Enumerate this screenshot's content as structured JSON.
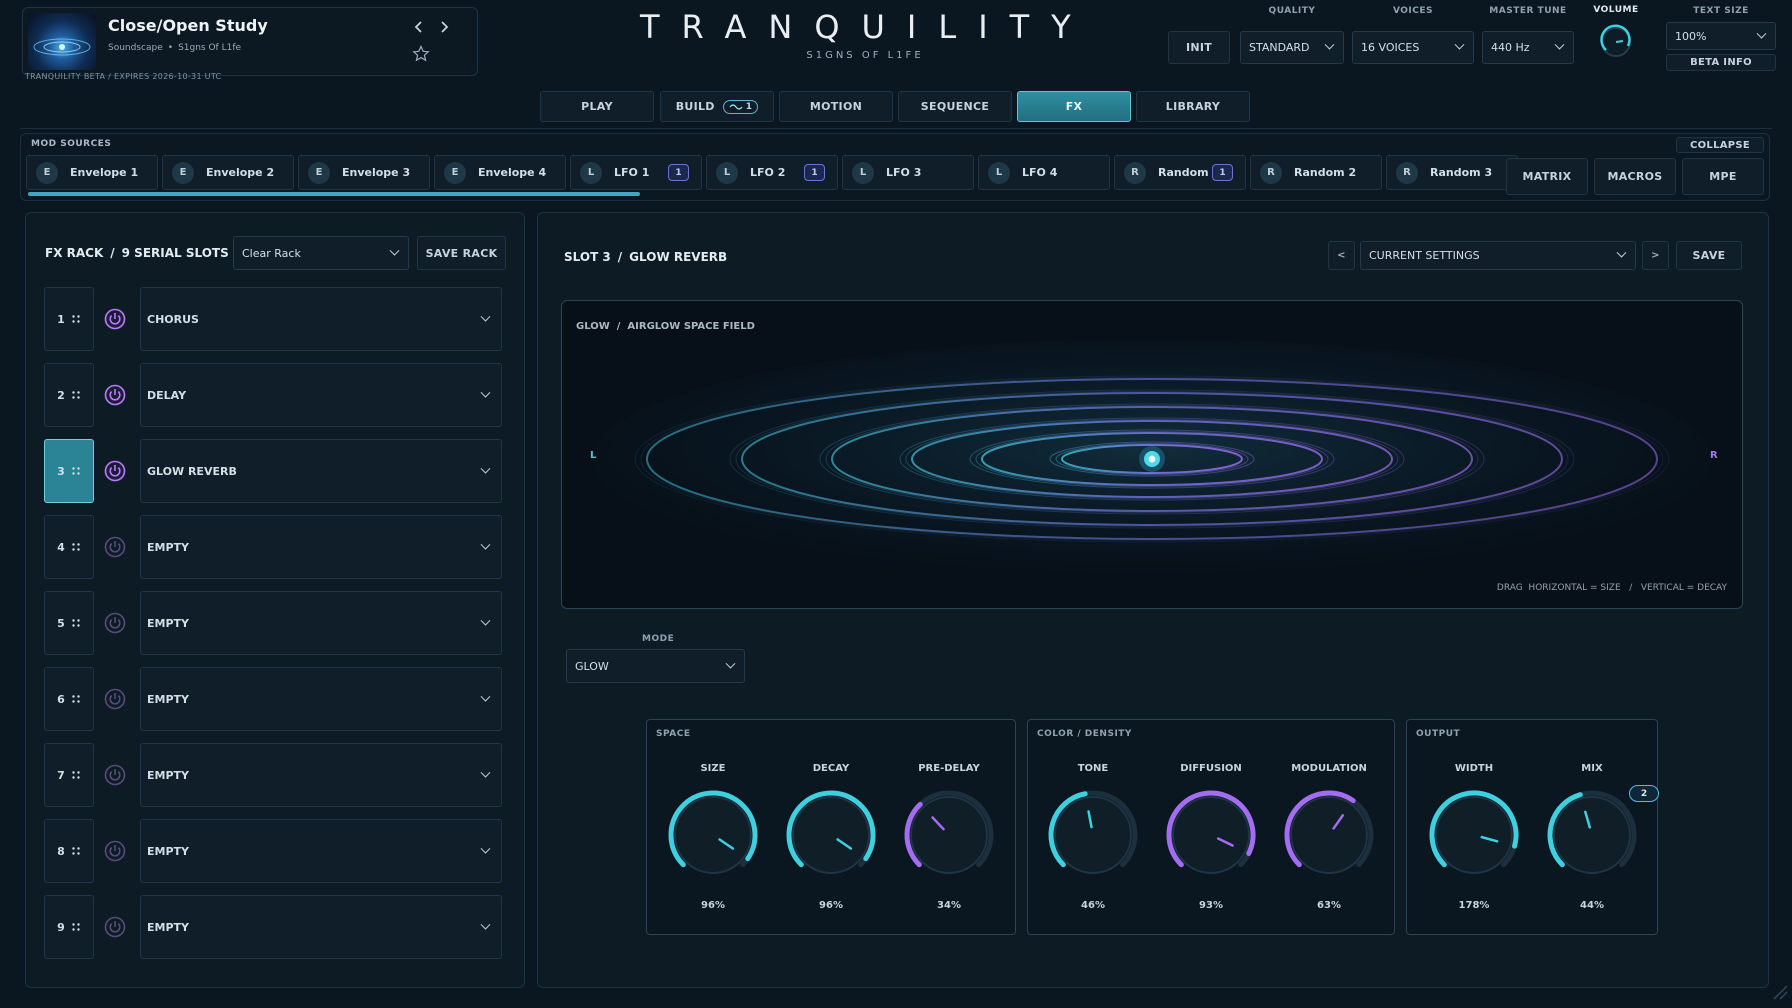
{
  "header": {
    "preset_title": "Close/Open Study",
    "preset_category": "Soundscape",
    "preset_bullet": "•",
    "preset_pack": "S1gns Of L1fe",
    "beta_line": "TRANQUILITY BETA  /  EXPIRES 2026-10-31 UTC",
    "brand": "TRANQUILITY",
    "brand_sub": "S1GNS OF L1FE",
    "init_label": "INIT",
    "quality_label": "QUALITY",
    "quality_value": "STANDARD",
    "voices_label": "VOICES",
    "voices_value": "16 VOICES",
    "tune_label": "MASTER TUNE",
    "tune_value": "440 Hz",
    "volume_label": "VOLUME",
    "text_size_label": "TEXT SIZE",
    "text_size_value": "100%",
    "beta_info": "BETA INFO"
  },
  "tabs": [
    {
      "label": "PLAY"
    },
    {
      "label": "BUILD",
      "badge": "1"
    },
    {
      "label": "MOTION"
    },
    {
      "label": "SEQUENCE"
    },
    {
      "label": "FX"
    },
    {
      "label": "LIBRARY"
    }
  ],
  "mod_sources": {
    "title": "MOD SOURCES",
    "collapse": "COLLAPSE",
    "items": [
      {
        "badge": "E",
        "label": "Envelope 1"
      },
      {
        "badge": "E",
        "label": "Envelope 2"
      },
      {
        "badge": "E",
        "label": "Envelope 3"
      },
      {
        "badge": "E",
        "label": "Envelope 4"
      },
      {
        "badge": "L",
        "label": "LFO 1",
        "count": "1"
      },
      {
        "badge": "L",
        "label": "LFO 2",
        "count": "1"
      },
      {
        "badge": "L",
        "label": "LFO 3"
      },
      {
        "badge": "L",
        "label": "LFO 4"
      },
      {
        "badge": "R",
        "label": "Random 1",
        "count": "1"
      },
      {
        "badge": "R",
        "label": "Random 2"
      },
      {
        "badge": "R",
        "label": "Random 3"
      }
    ],
    "matrix": "MATRIX",
    "macros": "MACROS",
    "mpe": "MPE"
  },
  "rack": {
    "title_a": "FX RACK",
    "sep": "/",
    "title_b": "9 SERIAL SLOTS",
    "clear_value": "Clear Rack",
    "save_rack": "SAVE RACK",
    "slots": [
      {
        "num": "1",
        "name": "CHORUS",
        "on": true
      },
      {
        "num": "2",
        "name": "DELAY",
        "on": true
      },
      {
        "num": "3",
        "name": "GLOW REVERB",
        "on": true,
        "selected": true
      },
      {
        "num": "4",
        "name": "EMPTY",
        "on": false
      },
      {
        "num": "5",
        "name": "EMPTY",
        "on": false
      },
      {
        "num": "6",
        "name": "EMPTY",
        "on": false
      },
      {
        "num": "7",
        "name": "EMPTY",
        "on": false
      },
      {
        "num": "8",
        "name": "EMPTY",
        "on": false
      },
      {
        "num": "9",
        "name": "EMPTY",
        "on": false
      }
    ]
  },
  "editor": {
    "slot_a": "SLOT 3",
    "sep": "/",
    "slot_b": "GLOW REVERB",
    "prev": "<",
    "next": ">",
    "settings_value": "CURRENT SETTINGS",
    "save": "SAVE",
    "field_a": "GLOW",
    "field_b": "AIRGLOW SPACE FIELD",
    "left_ch": "L",
    "right_ch": "R",
    "hint": "DRAG  HORIZONTAL = SIZE   /   VERTICAL = DECAY",
    "mode_label": "MODE",
    "mode_value": "GLOW"
  },
  "groups": [
    {
      "title": "SPACE",
      "knobs": [
        {
          "label": "SIZE",
          "value": "96%",
          "level": 0.96,
          "color": "#3fd0e0"
        },
        {
          "label": "DECAY",
          "value": "96%",
          "level": 0.96,
          "color": "#3fd0e0"
        },
        {
          "label": "PRE-DELAY",
          "value": "34%",
          "level": 0.34,
          "color": "#a46cf0"
        }
      ]
    },
    {
      "title": "COLOR / DENSITY",
      "knobs": [
        {
          "label": "TONE",
          "value": "46%",
          "level": 0.46,
          "color": "#3fd0e0"
        },
        {
          "label": "DIFFUSION",
          "value": "93%",
          "level": 0.93,
          "color": "#a46cf0"
        },
        {
          "label": "MODULATION",
          "value": "63%",
          "level": 0.63,
          "color": "#a46cf0"
        }
      ]
    },
    {
      "title": "OUTPUT",
      "knobs": [
        {
          "label": "WIDTH",
          "value": "178%",
          "level": 0.89,
          "color": "#3fd0e0"
        },
        {
          "label": "MIX",
          "value": "44%",
          "level": 0.44,
          "color": "#3fd0e0",
          "badge": "2"
        }
      ]
    }
  ]
}
